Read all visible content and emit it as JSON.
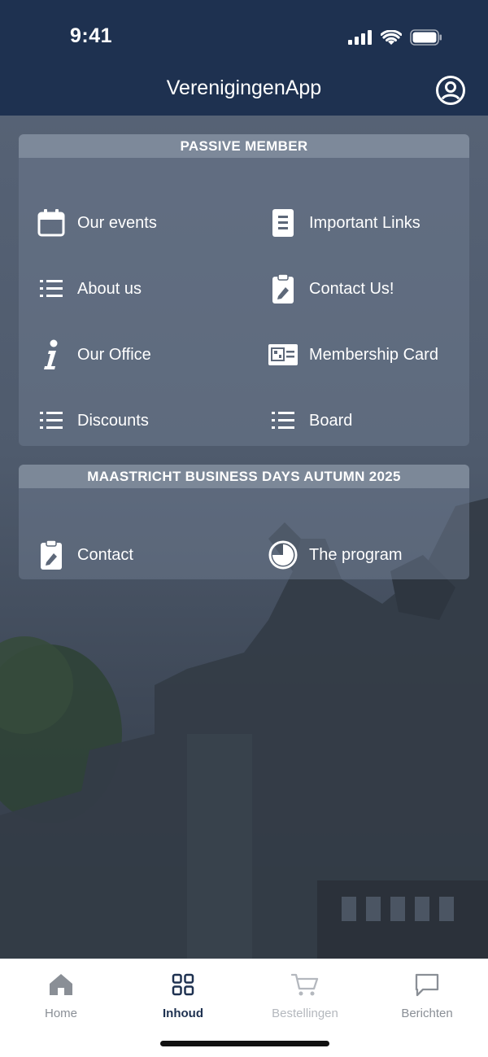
{
  "status_bar": {
    "time": "9:41"
  },
  "header": {
    "title": "VerenigingenApp",
    "profile_icon": "user-circle-icon"
  },
  "sections": [
    {
      "title": "PASSIVE MEMBER",
      "items": [
        {
          "label": "Our events",
          "icon": "calendar-icon"
        },
        {
          "label": "Important Links",
          "icon": "document-icon"
        },
        {
          "label": "About us",
          "icon": "list-icon"
        },
        {
          "label": "Contact Us!",
          "icon": "clipboard-icon"
        },
        {
          "label": "Our Office",
          "icon": "info-icon"
        },
        {
          "label": "Membership Card",
          "icon": "id-card-icon"
        },
        {
          "label": "Discounts",
          "icon": "list-icon"
        },
        {
          "label": "Board",
          "icon": "list-icon"
        }
      ]
    },
    {
      "title": "MAASTRICHT BUSINESS DAYS AUTUMN 2025",
      "items": [
        {
          "label": "Contact",
          "icon": "clipboard-icon"
        },
        {
          "label": "The program",
          "icon": "pie-chart-icon"
        }
      ]
    }
  ],
  "tabbar": {
    "active": "Inhoud",
    "tabs": [
      {
        "label": "Home",
        "icon": "home-icon"
      },
      {
        "label": "Inhoud",
        "icon": "grid-icon"
      },
      {
        "label": "Bestellingen",
        "icon": "cart-icon"
      },
      {
        "label": "Berichten",
        "icon": "message-icon"
      }
    ]
  },
  "colors": {
    "header_bg": "#1e3150",
    "active_tab": "#1e3150",
    "inactive_tab": "#8a8f96"
  }
}
